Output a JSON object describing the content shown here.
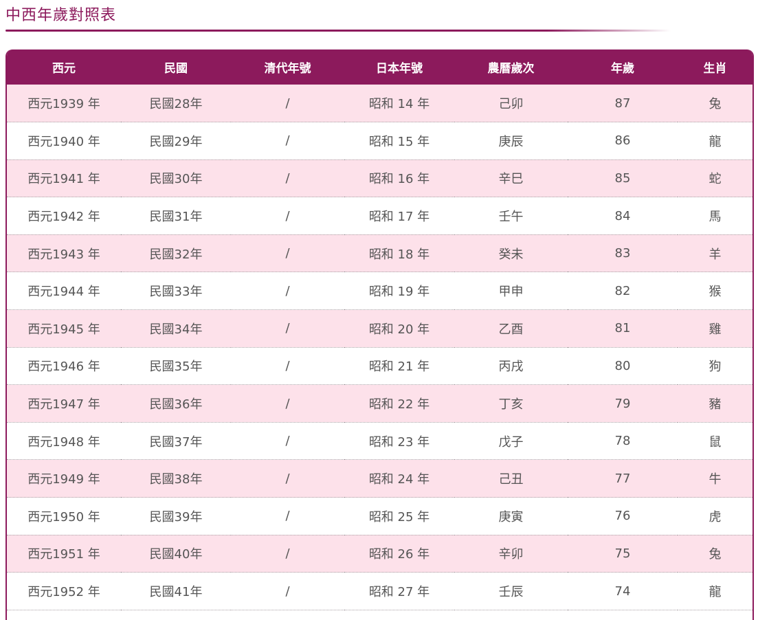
{
  "page": {
    "title": "中西年歲對照表"
  },
  "table": {
    "headers": [
      "西元",
      "民國",
      "清代年號",
      "日本年號",
      "農曆歲次",
      "年歲",
      "生肖"
    ],
    "rows": [
      [
        "西元1939 年",
        "民國28年",
        "/",
        "昭和 14 年",
        "己卯",
        "87",
        "兔"
      ],
      [
        "西元1940 年",
        "民國29年",
        "/",
        "昭和 15 年",
        "庚辰",
        "86",
        "龍"
      ],
      [
        "西元1941 年",
        "民國30年",
        "/",
        "昭和 16 年",
        "辛巳",
        "85",
        "蛇"
      ],
      [
        "西元1942 年",
        "民國31年",
        "/",
        "昭和 17 年",
        "壬午",
        "84",
        "馬"
      ],
      [
        "西元1943 年",
        "民國32年",
        "/",
        "昭和 18 年",
        "癸未",
        "83",
        "羊"
      ],
      [
        "西元1944 年",
        "民國33年",
        "/",
        "昭和 19 年",
        "甲申",
        "82",
        "猴"
      ],
      [
        "西元1945 年",
        "民國34年",
        "/",
        "昭和 20 年",
        "乙酉",
        "81",
        "雞"
      ],
      [
        "西元1946 年",
        "民國35年",
        "/",
        "昭和 21 年",
        "丙戌",
        "80",
        "狗"
      ],
      [
        "西元1947 年",
        "民國36年",
        "/",
        "昭和 22 年",
        "丁亥",
        "79",
        "豬"
      ],
      [
        "西元1948 年",
        "民國37年",
        "/",
        "昭和 23 年",
        "戊子",
        "78",
        "鼠"
      ],
      [
        "西元1949 年",
        "民國38年",
        "/",
        "昭和 24 年",
        "己丑",
        "77",
        "牛"
      ],
      [
        "西元1950 年",
        "民國39年",
        "/",
        "昭和 25 年",
        "庚寅",
        "76",
        "虎"
      ],
      [
        "西元1951 年",
        "民國40年",
        "/",
        "昭和 26 年",
        "辛卯",
        "75",
        "兔"
      ],
      [
        "西元1952 年",
        "民國41年",
        "/",
        "昭和 27 年",
        "壬辰",
        "74",
        "龍"
      ]
    ]
  },
  "colors": {
    "accent": "#8c1a5c",
    "row_alt": "#fde1ea",
    "row_plain": "#ffffff"
  }
}
